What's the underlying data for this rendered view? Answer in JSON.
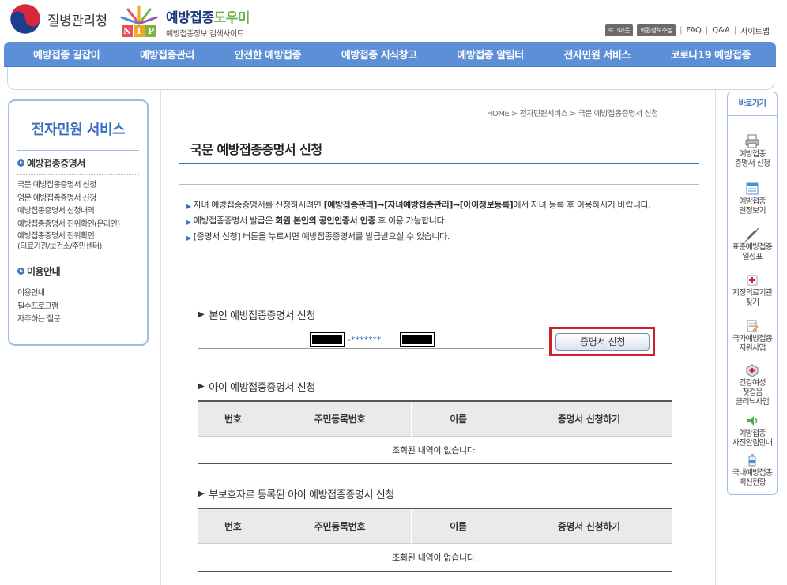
{
  "header": {
    "org_name": "질병관리청",
    "site_title_main": "예방접종",
    "site_title_accent": "도우미",
    "site_subtitle": "예방접종정보 검색사이트",
    "nip_letters": [
      "N",
      "I",
      "P"
    ],
    "logout_label": "로그아웃",
    "member_edit_label": "회원정보수정",
    "faq_label": "FAQ",
    "qa_label": "Q&A",
    "sitemap_label": "사이트맵"
  },
  "nav": {
    "items": [
      {
        "label": "예방접종 길잡이"
      },
      {
        "label": "예방접종관리"
      },
      {
        "label": "안전한 예방접종"
      },
      {
        "label": "예방접종 지식창고"
      },
      {
        "label": "예방접종 알림터"
      },
      {
        "label": "전자민원 서비스"
      },
      {
        "label": "코로나19 예방접종"
      }
    ]
  },
  "left_sidebar": {
    "title": "전자민원 서비스",
    "section1": {
      "label": "예방접종증명서",
      "links": [
        {
          "label": "국문 예방접종증명서 신청"
        },
        {
          "label": "영문 예방접종증명서 신청"
        },
        {
          "label": "예방접종증명서 신청내역"
        },
        {
          "label": "예방접종증명서 진위확인(온라인)"
        },
        {
          "label": "예방접종증명서 진위확인"
        },
        {
          "label": "(의료기관/보건소/주민센터)"
        }
      ]
    },
    "section2": {
      "label": "이용안내",
      "links": [
        {
          "label": "이용안내"
        },
        {
          "label": "필수프로그램"
        },
        {
          "label": "자주하는 질문"
        }
      ]
    }
  },
  "breadcrumb": "HOME > 전자민원서비스 > 국문 예방접종증명서 신청",
  "page_title": "국문 예방접종증명서 신청",
  "notices": {
    "n1_a": "자녀 예방접종증명서를 신청하시려면 ",
    "n1_b": "[예방접종관리]→[자녀예방접종관리]→[아이정보등록]",
    "n1_c": "에서 자녀 등록 후 이용하시기 바랍니다.",
    "n2_a": "예방접종증명서 발급은 ",
    "n2_b": "회원 본인의 공인인증서 인증",
    "n2_c": " 후 이용 가능합니다.",
    "n3": "[증명서 신청] 버튼을 누르시면 예방접종증명서를 발급받으실 수 있습니다."
  },
  "self_section": {
    "heading": "본인 예방접종증명서 신청",
    "masked_id": "-*******",
    "button_label": "증명서 신청"
  },
  "child_section": {
    "heading": "아이 예방접종증명서 신청",
    "columns": [
      "번호",
      "주민등록번호",
      "이름",
      "증명서 신청하기"
    ],
    "empty_message": "조회된 내역이 없습니다."
  },
  "guardian_section": {
    "heading": "부보호자로 등록된 아이 예방접종증명서 신청",
    "columns": [
      "번호",
      "주민등록번호",
      "이름",
      "증명서 신청하기"
    ],
    "empty_message": "조회된 내역이 없습니다."
  },
  "right_sidebar": {
    "title": "바로가기",
    "items": [
      {
        "line1": "예방접종",
        "line2": "증명서 신청",
        "icon": "printer-icon"
      },
      {
        "line1": "예방접종",
        "line2": "일정보기",
        "icon": "calendar-icon"
      },
      {
        "line1": "표준예방접종",
        "line2": "일정표",
        "icon": "syringe-icon"
      },
      {
        "line1": "지정의료기관",
        "line2": "찾기",
        "icon": "hospital-icon"
      },
      {
        "line1": "국가예방접종",
        "line2": "지원사업",
        "icon": "document-icon"
      },
      {
        "line1": "건강여성",
        "line2": "첫걸음",
        "line3": "클리닉사업",
        "icon": "medkit-icon"
      },
      {
        "line1": "예방접종",
        "line2": "사전알림안내",
        "icon": "speaker-icon"
      },
      {
        "line1": "국내예방접종",
        "line2": "백신현황",
        "icon": "vaccine-bottle-icon"
      }
    ]
  },
  "colors": {
    "nav_blue": "#5d8fd6",
    "title_blue": "#3a6fc0",
    "highlight_red": "#d0202a",
    "nip_n": "#e8505b",
    "nip_i": "#f5a623",
    "nip_p": "#7cb342"
  }
}
